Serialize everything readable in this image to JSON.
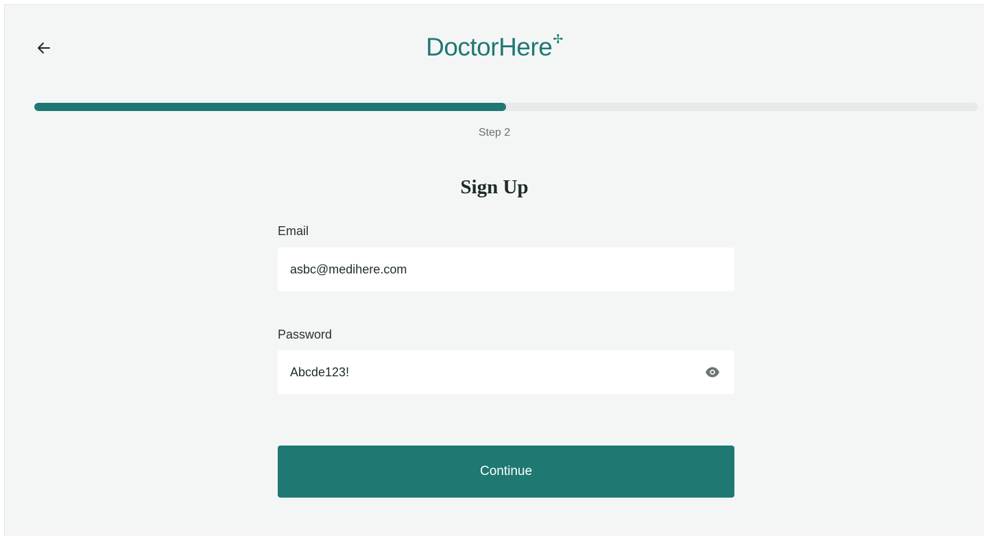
{
  "header": {
    "back_icon": "arrow-left-icon",
    "logo_text": "DoctorHere",
    "logo_mark": "✢",
    "brand_color": "#1f7872"
  },
  "progress": {
    "fraction": 0.5,
    "step_label": "Step 2"
  },
  "form": {
    "title": "Sign Up",
    "email": {
      "label": "Email",
      "value": "asbc@medihere.com"
    },
    "password": {
      "label": "Password",
      "value": "Abcde123!",
      "toggle_icon": "eye-icon"
    },
    "submit_label": "Continue"
  }
}
